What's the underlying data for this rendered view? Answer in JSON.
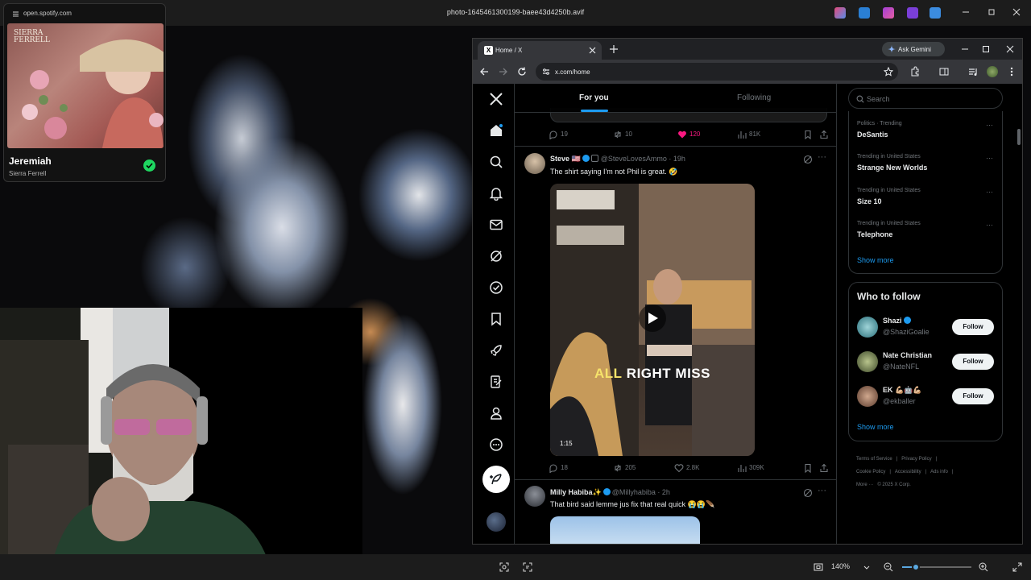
{
  "viewer": {
    "title": "photo-1645461300199-baee43d4250b.avif",
    "zoom": "140%",
    "zoom_fraction": 0.2
  },
  "spotify": {
    "url": "open.spotify.com",
    "art_title": "SIERRA FERRELL",
    "track": "Jeremiah",
    "artist": "Sierra Ferrell"
  },
  "browser": {
    "tab_title": "Home / X",
    "url": "x.com/home",
    "gemini": "Ask Gemini"
  },
  "feed": {
    "tab_foryou": "For you",
    "tab_following": "Following",
    "prev_actions": {
      "replies": "19",
      "reposts": "10",
      "likes": "120",
      "views": "81K"
    },
    "tweets": [
      {
        "name": "Steve 🇺🇸",
        "handle": "@SteveLovesAmmo · 19h",
        "text": "The shirt saying I'm not Phil is great. 🤣",
        "caption_a": "ALL",
        "caption_b": "RIGHT MISS",
        "duration": "1:15",
        "replies": "18",
        "reposts": "205",
        "likes": "2.8K",
        "views": "309K"
      },
      {
        "name": "Milly Habiba✨",
        "handle": "@Millyhabiba · 2h",
        "text": "That bird said lemme jus fix that real quick 😭😭🪶"
      }
    ]
  },
  "sidebar": {
    "search_placeholder": "Search",
    "trends": [
      {
        "meta": "Politics · Trending",
        "name": "DeSantis"
      },
      {
        "meta": "Trending in United States",
        "name": "Strange New Worlds"
      },
      {
        "meta": "Trending in United States",
        "name": "Size 10"
      },
      {
        "meta": "Trending in United States",
        "name": "Telephone"
      }
    ],
    "show_more": "Show more",
    "who_to_follow": "Who to follow",
    "follow_label": "Follow",
    "follows": [
      {
        "name": "Shazi",
        "handle": "@ShaziGoalie",
        "color": "#2a6f7a"
      },
      {
        "name": "Nate Christian",
        "handle": "@NateNFL",
        "color": "#6c7a4a"
      },
      {
        "name": "EK 💪🏼🤖💪🏼",
        "handle": "@ekballer",
        "color": "#7a5a48"
      }
    ],
    "footer": [
      "Terms of Service",
      "|",
      "Privacy Policy",
      "|",
      "Cookie Policy",
      "|",
      "Accessibility",
      "|",
      "Ads info",
      "|",
      "More ···",
      "© 2025 X Corp."
    ]
  },
  "colors": {
    "accent": "#1d9bf0",
    "like": "#f91880",
    "spotify_green": "#1ed760"
  }
}
